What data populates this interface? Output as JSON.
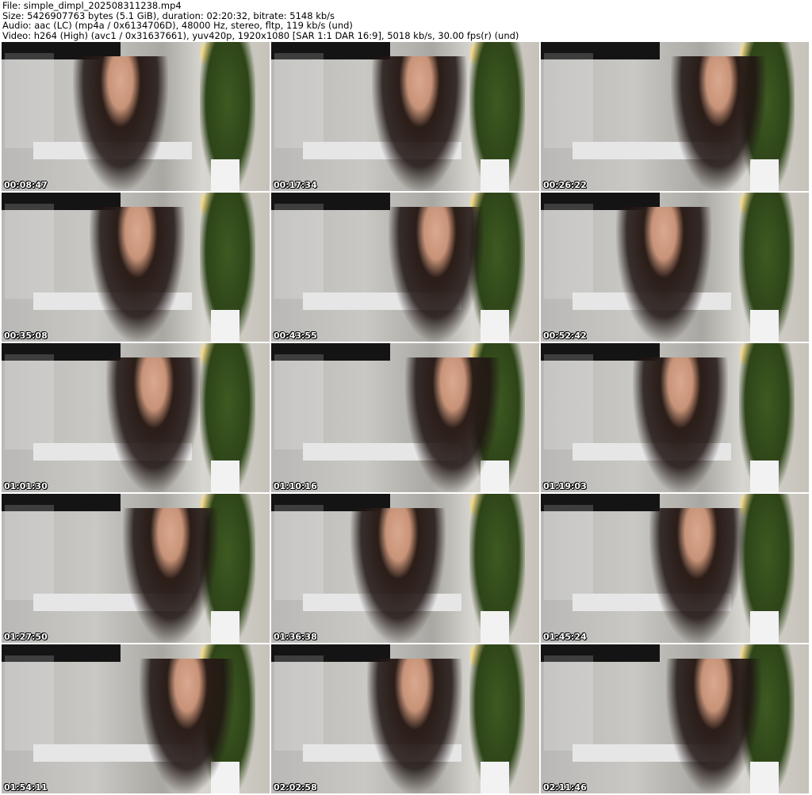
{
  "info": {
    "file": "File: simple_dimpl_202508311238.mp4",
    "size": "Size: 5426907763 bytes (5.1 GiB), duration: 02:20:32, bitrate: 5148 kb/s",
    "audio": "Audio: aac (LC) (mp4a / 0x6134706D), 48000 Hz, stereo, fltp, 119 kb/s (und)",
    "video": "Video: h264 (High) (avc1 / 0x31637661), yuv420p, 1920x1080 [SAR 1:1 DAR 16:9], 5018 kb/s, 30.00 fps(r) (und)"
  },
  "thumbnails": [
    {
      "timestamp": "00:08:47"
    },
    {
      "timestamp": "00:17:34"
    },
    {
      "timestamp": "00:26:22"
    },
    {
      "timestamp": "00:35:08"
    },
    {
      "timestamp": "00:43:55"
    },
    {
      "timestamp": "00:52:42"
    },
    {
      "timestamp": "01:01:30"
    },
    {
      "timestamp": "01:10:16"
    },
    {
      "timestamp": "01:19:03"
    },
    {
      "timestamp": "01:27:50"
    },
    {
      "timestamp": "01:36:38"
    },
    {
      "timestamp": "01:45:24"
    },
    {
      "timestamp": "01:54:11"
    },
    {
      "timestamp": "02:02:58"
    },
    {
      "timestamp": "02:11:46"
    }
  ]
}
